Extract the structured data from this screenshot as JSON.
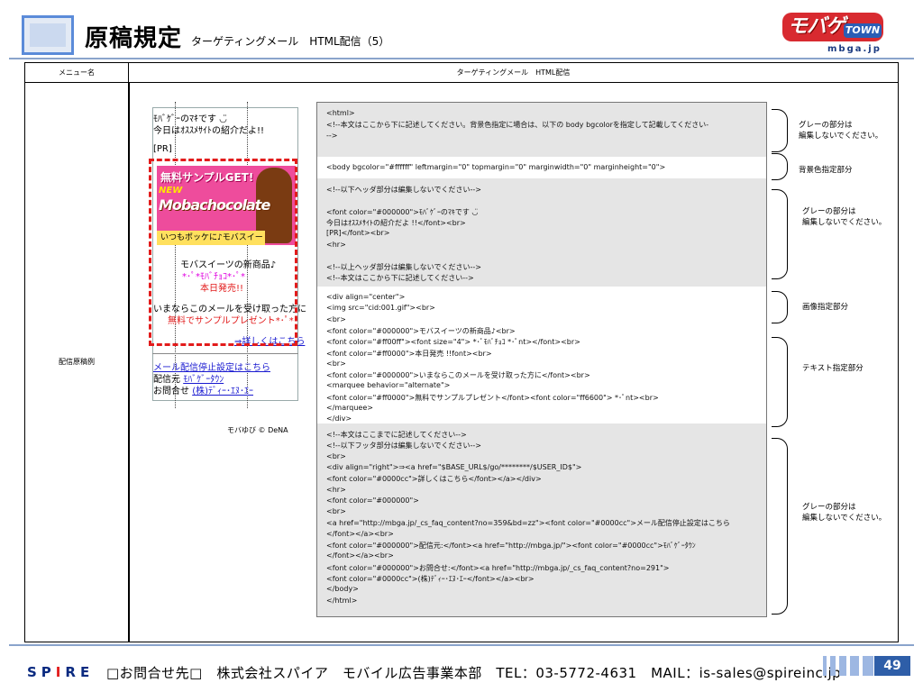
{
  "header": {
    "title": "原稿規定",
    "subtitle": "ターゲティングメール　HTML配信（5）",
    "logo_text": "モバゲー",
    "logo_town": "TOWN",
    "logo_url": "mbga.jp"
  },
  "table": {
    "col1_header": "メニュー名",
    "col2_header": "ターゲティングメール　HTML配信",
    "row_label": "配信原稿例"
  },
  "preview": {
    "line1": "ﾓﾊﾞｹﾞｰのﾏｷです ◡̈",
    "line2": "今日はｵｽｽﾒｻｲﾄの紹介だよ!!",
    "line3": "[PR]",
    "banner_title": "無料サンプルGET!",
    "banner_new": "NEW",
    "banner_product": "Mobachocolate",
    "banner_tagline": "いつもポッケに♪モバスイーツ",
    "line4": "モバスイーツの新商品♪",
    "line5": "*･ﾟ*ﾓﾊﾞﾁｮｺ*･ﾟ*",
    "line6": "本日発売!!",
    "line7": "いまならこのメールを受け取った方に",
    "line8": "無料でサンプルプレゼント*･ﾟ*",
    "line9": "⇒詳しくはこちら",
    "link1": "メール配信停止設定はこちら",
    "line10a": "配信元",
    "link2": "ﾓﾊﾞｹﾞｰﾀｳﾝ",
    "line11a": "お問合せ",
    "link3": "(株)ﾃﾞｨｰ･ｴﾇ･ｴｰ",
    "copyright": "モバゆび © DeNA"
  },
  "code_lines": {
    "s1": [
      "<html>",
      "<!--本文はここから下に記述してください。背景色指定に場合は、以下の body bgcolorを指定して記載してください-",
      "-->"
    ],
    "s2": [
      "<body bgcolor=\"#ffffff\" leftmargin=\"0\" topmargin=\"0\" marginwidth=\"0\" marginheight=\"0\">"
    ],
    "s3": [
      "<!--以下ヘッダ部分は編集しないでください-->",
      "",
      "<font color=\"#000000\">ﾓﾊﾞｹﾞｰのﾏｷです ◡̈",
      "今日はｵｽｽﾒｻｲﾄの紹介だよ !!</font><br>",
      "[PR]</font><br>",
      "<hr>",
      "",
      "<!--以上ヘッダ部分は編集しないでください-->",
      "<!--本文はここから下に記述してください-->"
    ],
    "s4": [
      "<div align=\"center\">",
      "<img src=\"cid:001.gif\"><br>",
      "<br>",
      "<font color=\"#000000\">モバスイーツの新商品♪<br>",
      "<font color=\"#ff00ff\"><font size=\"4\"> *･ﾟﾓﾊﾞﾁｮｺ *･ﾟnt></font><br>",
      "<font color=\"#ff0000\">本日発売 !!font><br>",
      "<br>",
      "<font color=\"#000000\">いまならこのメールを受け取った方に</font><br>",
      "<marquee behavior=\"alternate\">",
      "<font color=\"#ff0000\">無料でサンプルプレゼント</font><font color=\"ff6600\"> *･ﾟnt><br>",
      "</marquee>",
      "</div>"
    ],
    "s5": [
      "<!--本文はここまでに記述してください-->",
      "<!--以下フッタ部分は編集しないでください-->",
      "<br>",
      "<div align=\"right\">⇒<a href=\"$BASE_URL$/go/********/$USER_ID$\">",
      "<font color=\"#0000cc\">詳しくはこちら</font></a></div>",
      "<hr>",
      "<font color=\"#000000\">",
      "<br>",
      "<a href=\"http://mbga.jp/_cs_faq_content?no=359&bd=zz\"><font color=\"#0000cc\">メール配信停止設定はこちら",
      "</font></a><br>",
      "<font color=\"#000000\">配信元:</font><a href=\"http://mbga.jp/\"><font color=\"#0000cc\">ﾓﾊﾞｹﾞｰﾀｳﾝ",
      "</font></a><br>",
      "<font color=\"#000000\">お問合せ:</font><a href=\"http://mbga.jp/_cs_faq_content?no=291\">",
      "<font color=\"#0000cc\">(株)ﾃﾞｨｰ･ｴﾇ･ｴｰ</font></a><br>",
      "</body>",
      "</html>"
    ]
  },
  "notes": {
    "n1": "グレーの部分は\n編集しないでください。",
    "n2": "背景色指定部分",
    "n3": "グレーの部分は\n編集しないでください。",
    "n4": "画像指定部分",
    "n5": "テキスト指定部分",
    "n6": "グレーの部分は\n編集しないでください。"
  },
  "footer": {
    "spire_left": "SP",
    "spire_i": "I",
    "spire_right": "RE",
    "contact": "□お問合せ先□　株式会社スパイア　モバイル広告事業本部　TEL：03-5772-4631　MAIL：is-sales@spireinc.jp",
    "page": "49"
  }
}
